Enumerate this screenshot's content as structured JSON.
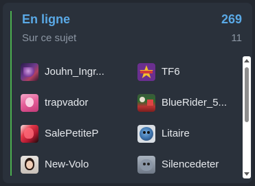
{
  "panel": {
    "title": "En ligne",
    "online_count": "269",
    "subtitle": "Sur ce sujet",
    "topic_count": "11",
    "accent_color": "#4caf50",
    "title_color": "#5aa9e6"
  },
  "users": [
    {
      "name": "Jouhn_Ingr...",
      "avatar": "user-avatar-purple-scene"
    },
    {
      "name": "TF6",
      "avatar": "user-avatar-star-badge"
    },
    {
      "name": "trapvador",
      "avatar": "user-avatar-pink-photo"
    },
    {
      "name": "BlueRider_5...",
      "avatar": "user-avatar-christmas-scene"
    },
    {
      "name": "SalePetiteP",
      "avatar": "user-avatar-red-black"
    },
    {
      "name": "Litaire",
      "avatar": "user-avatar-blue-creature"
    },
    {
      "name": "New-Volo",
      "avatar": "user-avatar-portrait"
    },
    {
      "name": "Silencedeter",
      "avatar": "user-avatar-gray-monster"
    }
  ]
}
